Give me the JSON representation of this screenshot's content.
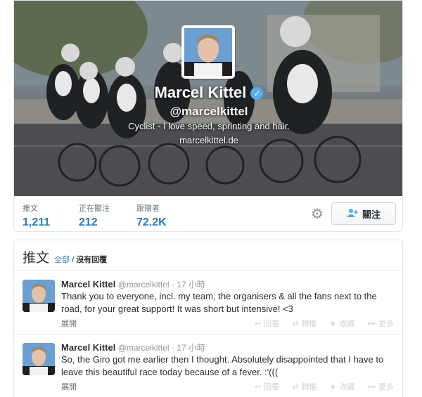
{
  "profile": {
    "name": "Marcel Kittel",
    "verified_mark": "✓",
    "handle": "@marcelkittel",
    "bio": "Cyclist - I love speed, sprinting and hair.",
    "url": "marcelkittel.de"
  },
  "stats": [
    {
      "label": "推文",
      "value": "1,211"
    },
    {
      "label": "正在關注",
      "value": "212"
    },
    {
      "label": "跟隨者",
      "value": "72.2K"
    }
  ],
  "settings_icon": "gear-icon",
  "follow_button": {
    "label": "關注",
    "icon": "add-user-icon"
  },
  "tweets_section": {
    "title": "推文",
    "filter_all": "全部",
    "filter_sep": " / ",
    "filter_no_replies": "沒有回覆"
  },
  "tweets": [
    {
      "name": "Marcel Kittel",
      "handle": "@marcelkittel",
      "time": "· 17 小時",
      "text": "Thank you to everyone, incl. my team, the organisers & all the fans next to the road, for your great support! It was short but intensive! <3",
      "expand": "展開"
    },
    {
      "name": "Marcel Kittel",
      "handle": "@marcelkittel",
      "time": "· 17 小時",
      "text": "So, the Giro got me earlier then I thought. Absolutely disappointed that I have to leave this beautiful race today because of a fever. :'(((",
      "expand": "展開"
    }
  ],
  "tweet_actions": {
    "reply": "回覆",
    "retweet": "轉推",
    "favorite": "收藏",
    "more": "更多"
  },
  "colors": {
    "link": "#2b7bb9",
    "verified": "#55acee",
    "muted": "#8899a6",
    "text": "#292f33"
  }
}
